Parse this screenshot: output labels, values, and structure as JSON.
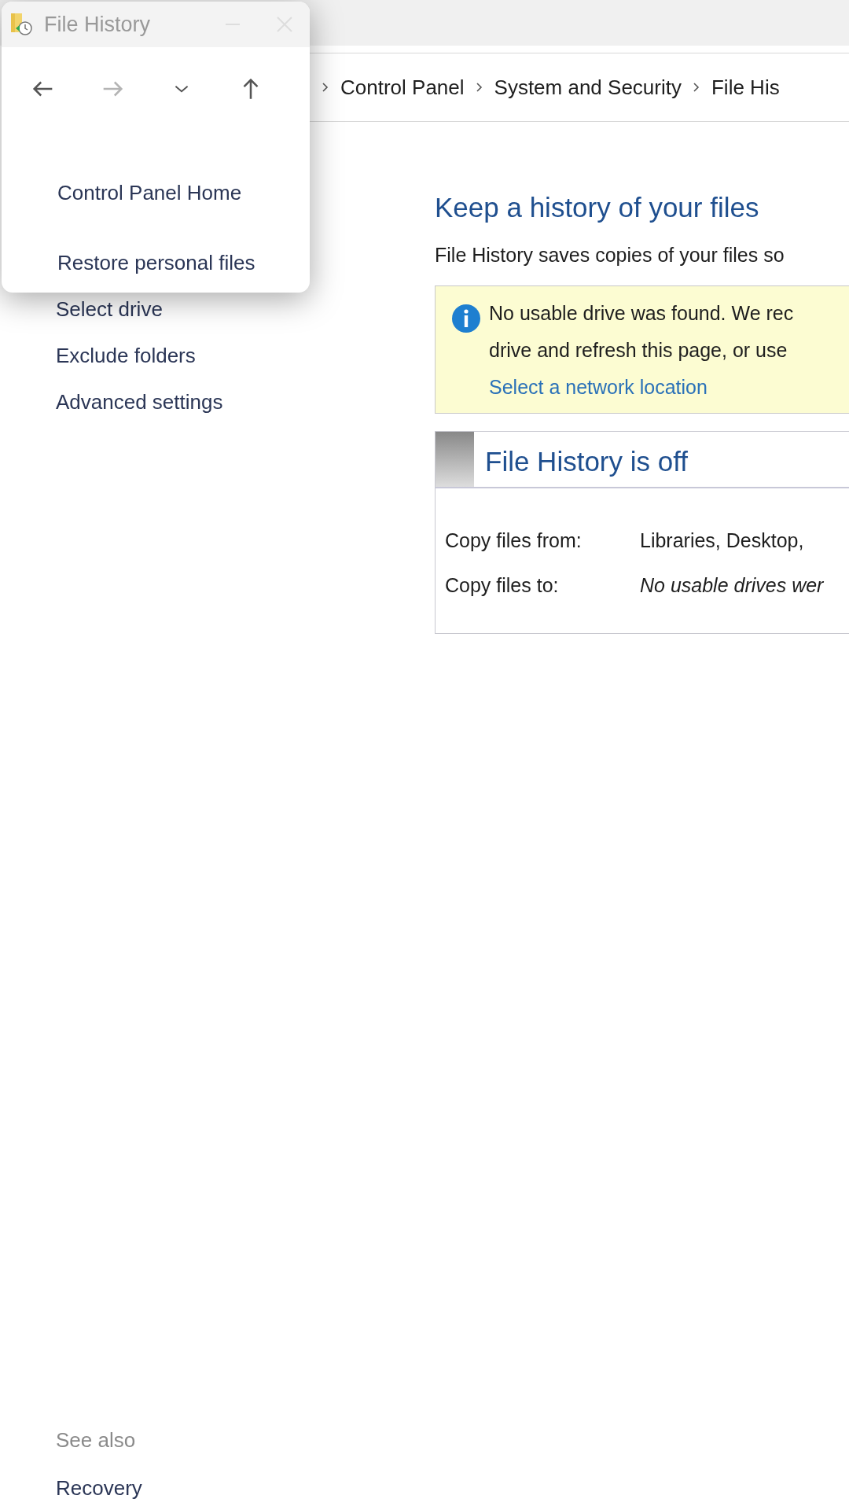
{
  "main_window": {
    "breadcrumb": [
      "Control Panel",
      "System and Security",
      "File His"
    ],
    "sidebar": {
      "items": [
        "Select drive",
        "Exclude folders",
        "Advanced settings"
      ],
      "see_also": {
        "title": "See also",
        "items": [
          "Recovery"
        ]
      }
    },
    "content": {
      "heading": "Keep a history of your files",
      "description": "File History saves copies of your files so",
      "info": {
        "lines": [
          "No usable drive was found. We rec",
          "drive and refresh this page, or use"
        ],
        "link": "Select a network location"
      },
      "status": {
        "title": "File History is off",
        "rows": [
          {
            "label": "Copy files from:",
            "value": "Libraries, Desktop,",
            "kind": "plain"
          },
          {
            "label": "Copy files to:",
            "value": "No usable drives wer",
            "kind": "note"
          }
        ]
      }
    }
  },
  "overlay_window": {
    "title": "File History",
    "nav": {
      "back": {
        "disabled": false
      },
      "forward": {
        "disabled": true
      }
    },
    "sidebar_items": [
      "Control Panel Home",
      "Restore personal files"
    ]
  }
}
